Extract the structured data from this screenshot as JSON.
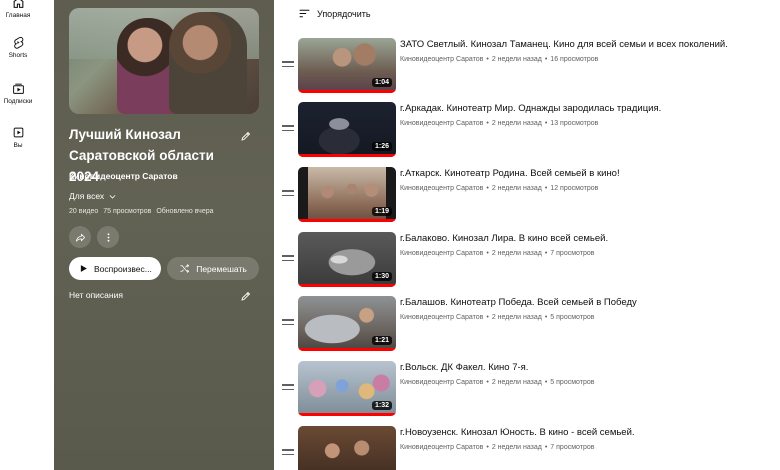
{
  "guide": {
    "items": [
      {
        "label": "Главная",
        "icon": "home-icon"
      },
      {
        "label": "Shorts",
        "icon": "shorts-icon"
      },
      {
        "label": "Подписки",
        "icon": "subscriptions-icon"
      },
      {
        "label": "Вы",
        "icon": "you-icon"
      }
    ]
  },
  "playlist": {
    "title_line1": "Лучший Кинозал",
    "title_line2": "Саратовской области 2024",
    "owner": "Киновидеоцентр Саратов",
    "visibility": "Для всех",
    "video_count": "20 видео",
    "views": "75 просмотров",
    "updated": "Обновлено вчера",
    "play_label": "Воспроизвес...",
    "shuffle_label": "Перемешать",
    "description": "Нет описания",
    "panel_color": "#5e5d4f"
  },
  "sort": {
    "label": "Упорядочить"
  },
  "videos": [
    {
      "title": "ЗАТО Светлый. Кинозал Таманец. Кино для всей семьи и всех поколений.",
      "channel": "Киновидеоцентр Саратов",
      "age": "2 недели назад",
      "views": "16 просмотров",
      "duration": "1:04",
      "watched": 1.0
    },
    {
      "title": "г.Аркадак. Кинотеатр Мир. Однажды зародилась традиция.",
      "channel": "Киновидеоцентр Саратов",
      "age": "2 недели назад",
      "views": "13 просмотров",
      "duration": "1:26",
      "watched": 1.0
    },
    {
      "title": "г.Аткарск. Кинотеатр Родина. Всей семьей в кино!",
      "channel": "Киновидеоцентр Саратов",
      "age": "2 недели назад",
      "views": "12 просмотров",
      "duration": "1:19",
      "watched": 1.0
    },
    {
      "title": "г.Балаково. Кинозал Лира. В кино всей семьей.",
      "channel": "Киновидеоцентр Саратов",
      "age": "2 недели назад",
      "views": "7 просмотров",
      "duration": "1:30",
      "watched": 1.0
    },
    {
      "title": "г.Балашов. Кинотеатр Победа. Всей семьей в Победу",
      "channel": "Киновидеоцентр Саратов",
      "age": "2 недели назад",
      "views": "5 просмотров",
      "duration": "1:21",
      "watched": 1.0
    },
    {
      "title": "г.Вольск. ДК Факел. Кино 7-я.",
      "channel": "Киновидеоцентр Саратов",
      "age": "2 недели назад",
      "views": "5 просмотров",
      "duration": "1:32",
      "watched": 1.0
    },
    {
      "title": "г.Новоузенск. Кинозал Юность. В кино - всей семьей.",
      "channel": "Киновидеоцентр Саратов",
      "age": "2 недели назад",
      "views": "7 просмотров",
      "duration": "",
      "watched": 1.0
    }
  ]
}
